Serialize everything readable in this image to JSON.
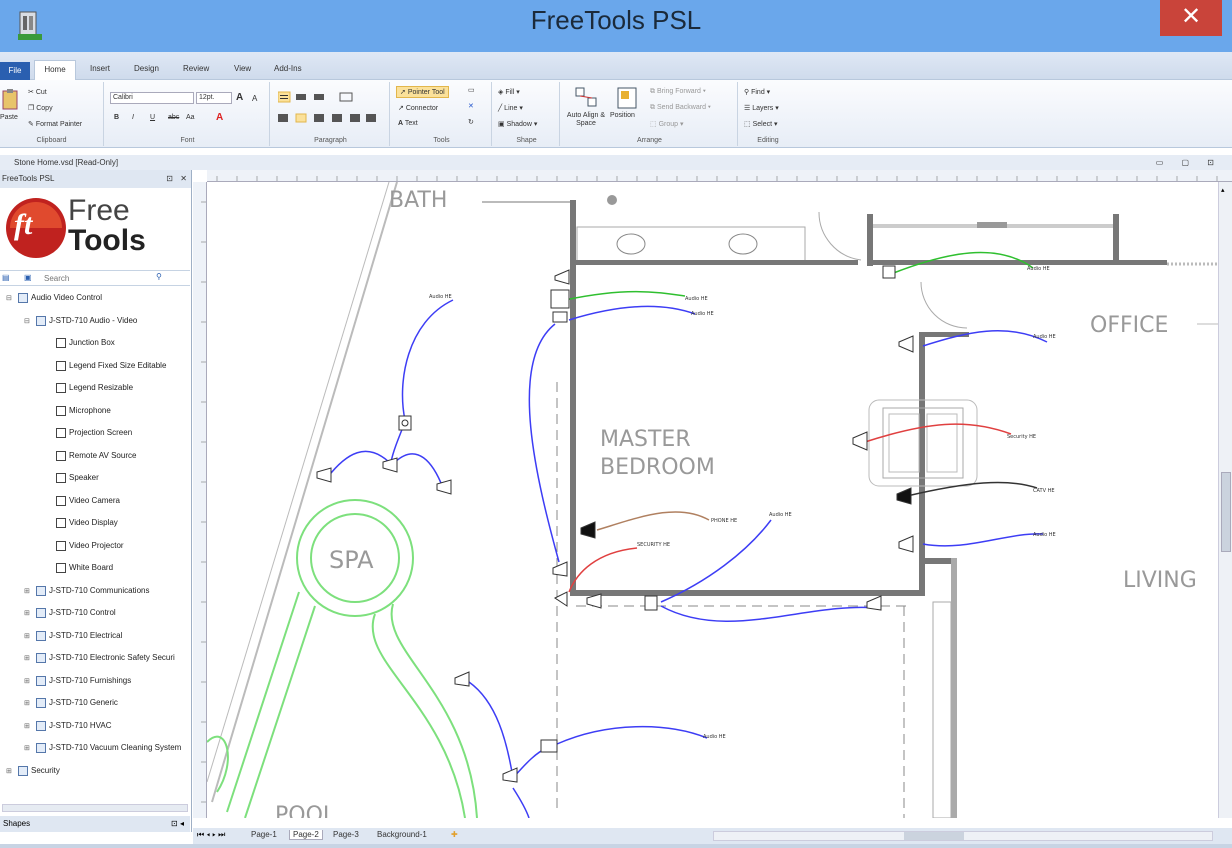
{
  "window": {
    "title": "FreeTools PSL",
    "close_glyph": "✕"
  },
  "ribbon_tabs": [
    "File",
    "Home",
    "Insert",
    "Design",
    "Review",
    "View",
    "Add-Ins"
  ],
  "ribbon": {
    "clipboard": {
      "paste": "Paste",
      "cut": "Cut",
      "copy": "Copy",
      "format_painter": "Format Painter",
      "label": "Clipboard"
    },
    "font": {
      "family": "Calibri",
      "size": "12pt.",
      "grow": "A",
      "shrink": "A",
      "bold": "B",
      "italic": "I",
      "underline": "U",
      "strike": "abc",
      "case": "Aa",
      "color": "A",
      "label": "Font"
    },
    "paragraph": {
      "label": "Paragraph"
    },
    "tools": {
      "pointer": "Pointer Tool",
      "connector": "Connector",
      "text": "Text",
      "label": "Tools"
    },
    "shape": {
      "fill": "Fill",
      "line": "Line",
      "shadow": "Shadow",
      "label": "Shape"
    },
    "arrange": {
      "auto_align": "Auto Align & Space",
      "position": "Position",
      "bring_forward": "Bring Forward",
      "send_backward": "Send Backward",
      "group": "Group",
      "label": "Arrange"
    },
    "editing": {
      "find": "Find",
      "layers": "Layers",
      "select": "Select",
      "label": "Editing"
    }
  },
  "document": {
    "title": "Stone Home.vsd [Read-Only]"
  },
  "sidebar": {
    "title": "FreeTools PSL",
    "logo": {
      "free": "Free",
      "tools": "Tools",
      "mark": "ft"
    },
    "search_placeholder": "Search",
    "tree": [
      {
        "label": "Audio Video Control",
        "level": 0
      },
      {
        "label": "J-STD-710 Audio - Video",
        "level": 1
      },
      {
        "label": "Junction Box",
        "level": 2
      },
      {
        "label": "Legend Fixed Size Editable",
        "level": 2
      },
      {
        "label": "Legend Resizable",
        "level": 2
      },
      {
        "label": "Microphone",
        "level": 2
      },
      {
        "label": "Projection Screen",
        "level": 2
      },
      {
        "label": "Remote AV Source",
        "level": 2
      },
      {
        "label": "Speaker",
        "level": 2
      },
      {
        "label": "Video Camera",
        "level": 2
      },
      {
        "label": "Video Display",
        "level": 2
      },
      {
        "label": "Video Projector",
        "level": 2
      },
      {
        "label": "White Board",
        "level": 2
      },
      {
        "label": "J-STD-710 Communications",
        "level": 1
      },
      {
        "label": "J-STD-710 Control",
        "level": 1
      },
      {
        "label": "J-STD-710 Electrical",
        "level": 1
      },
      {
        "label": "J-STD-710 Electronic Safety Securi",
        "level": 1
      },
      {
        "label": "J-STD-710 Furnishings",
        "level": 1
      },
      {
        "label": "J-STD-710 Generic",
        "level": 1
      },
      {
        "label": "J-STD-710 HVAC",
        "level": 1
      },
      {
        "label": "J-STD-710 Vacuum Cleaning System",
        "level": 1
      },
      {
        "label": "Security",
        "level": 0
      }
    ],
    "footer": "Shapes"
  },
  "drawing": {
    "rooms": {
      "bath": "BATH",
      "office": "OFFICE",
      "master1": "MASTER",
      "master2": "BEDROOM",
      "living": "LIVING",
      "spa": "SPA",
      "pool": "POOL"
    },
    "wire_labels": {
      "audio": "Audio HE",
      "security": "Security HE",
      "catv": "CATV HE",
      "phone": "PHONE HE",
      "security_upper": "SECURITY HE"
    }
  },
  "page_tabs": [
    "Page-1",
    "Page-2",
    "Page-3",
    "Background-1"
  ],
  "colors": {
    "title_bar": "#6aa7eb",
    "close": "#c9443a",
    "audio_wire": "#3d3df5",
    "security_wire": "#e04040",
    "data_wire": "#2fbf2f",
    "catv_wire": "#333333",
    "phone_wire": "#b08060",
    "wall": "#777777",
    "spa": "#7de07d"
  }
}
